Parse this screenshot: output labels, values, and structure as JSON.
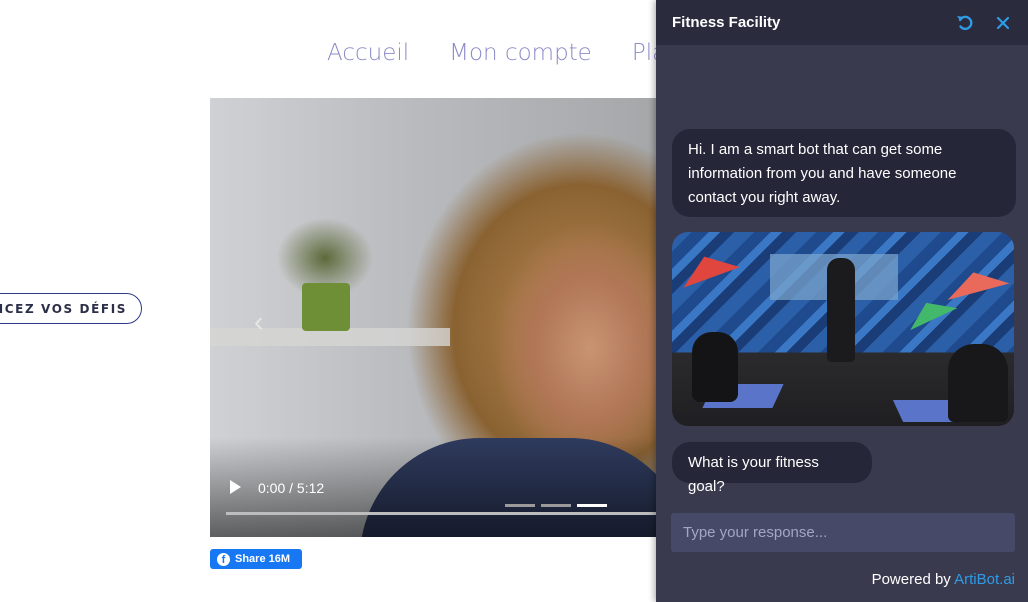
{
  "site": {
    "nav": [
      "Accueil",
      "Mon compte",
      "Pla"
    ],
    "cta_label": "NCEZ VOS DÉFIS",
    "video": {
      "time": "0:00 / 5:12",
      "slides": 3,
      "active_slide": 3
    },
    "share": {
      "label": "Share 16M"
    }
  },
  "chat": {
    "title": "Fitness Facility",
    "messages": [
      "Hi. I am a smart bot that can get some information from you and have someone contact you right away.",
      "What is your fitness goal?"
    ],
    "input_placeholder": "Type your response...",
    "powered_by": "Powered by",
    "brand": "ArtiBot.ai",
    "accent_color": "#2f9be6"
  }
}
